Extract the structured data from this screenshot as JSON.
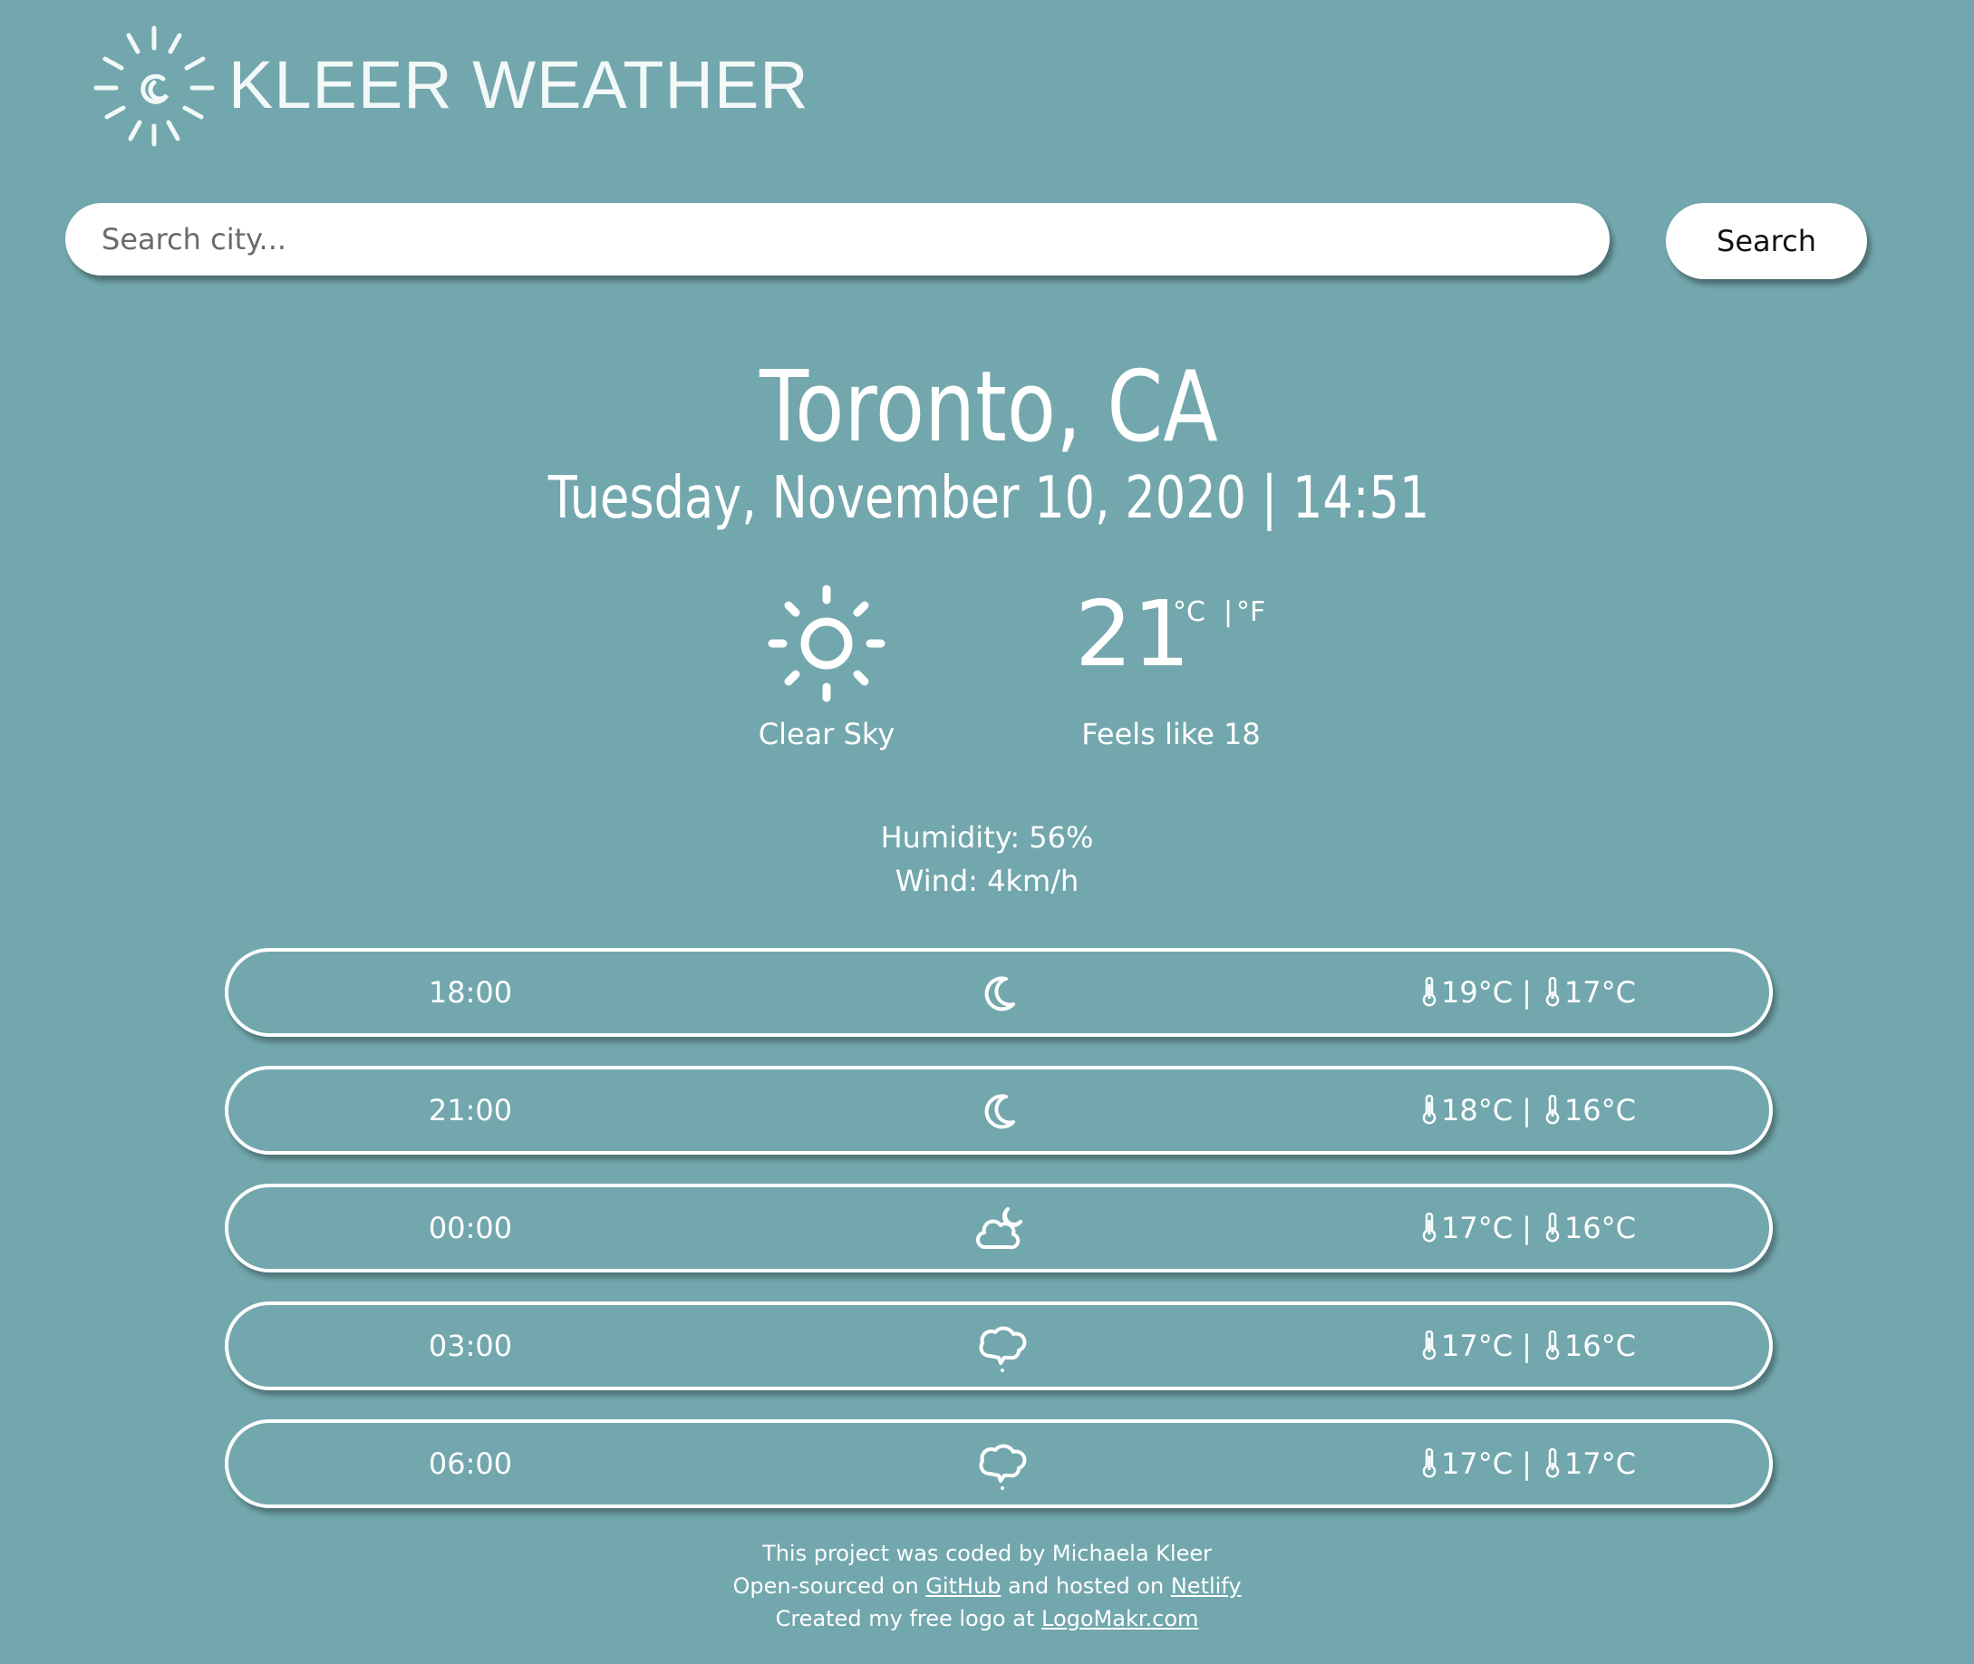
{
  "header": {
    "logo_text": "KLEER WEATHER"
  },
  "search": {
    "placeholder": "Search city...",
    "value": "",
    "button_label": "Search"
  },
  "location": {
    "city": "Toronto, CA",
    "datetime": "Tuesday, November 10, 2020 | 14:51"
  },
  "current": {
    "icon": "sun-icon",
    "condition": "Clear Sky",
    "temperature": "21",
    "unit_c": "°C",
    "unit_separator": "|",
    "unit_f": "°F",
    "feels_like": "Feels like 18",
    "humidity": "Humidity: 56%",
    "wind": "Wind: 4km/h"
  },
  "forecast": [
    {
      "time": "18:00",
      "icon": "moon-icon",
      "high": "19°C",
      "low": "17°C"
    },
    {
      "time": "21:00",
      "icon": "moon-icon",
      "high": "18°C",
      "low": "16°C"
    },
    {
      "time": "00:00",
      "icon": "cloud-moon-icon",
      "high": "17°C",
      "low": "16°C"
    },
    {
      "time": "03:00",
      "icon": "cloud-drizzle-icon",
      "high": "17°C",
      "low": "16°C"
    },
    {
      "time": "06:00",
      "icon": "cloud-drizzle-icon",
      "high": "17°C",
      "low": "17°C"
    }
  ],
  "footer": {
    "line1": "This project was coded by Michaela Kleer",
    "line2_prefix": "Open-sourced on ",
    "github_link": "GitHub",
    "line2_middle": " and hosted on ",
    "netlify_link": "Netlify",
    "line3_prefix": "Created my free logo at ",
    "logomakr_link": "LogoMakr.com"
  },
  "colors": {
    "background": "#72a7ad",
    "foreground": "#ffffff"
  }
}
